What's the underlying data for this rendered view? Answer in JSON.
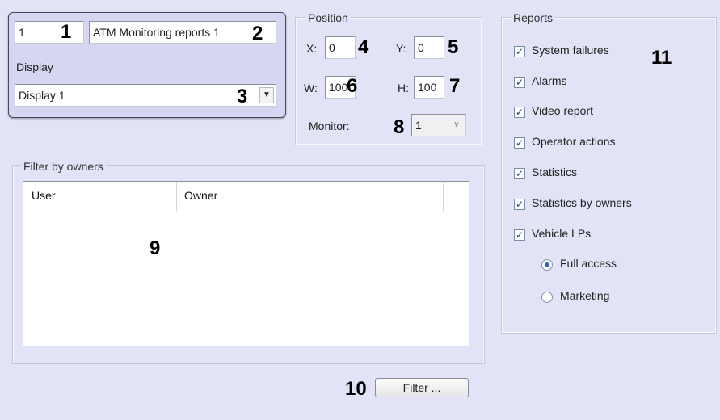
{
  "top_panel": {
    "id_value": "1",
    "name_value": "ATM Monitoring reports 1",
    "display_label": "Display",
    "display_value": "Display 1"
  },
  "position": {
    "legend": "Position",
    "x_label": "X:",
    "x_value": "0",
    "y_label": "Y:",
    "y_value": "0",
    "w_label": "W:",
    "w_value": "100",
    "h_label": "H:",
    "h_value": "100",
    "monitor_label": "Monitor:",
    "monitor_value": "1"
  },
  "filter_group": {
    "legend": "Filter by owners",
    "columns": [
      "User",
      "Owner"
    ],
    "filter_button": "Filter ..."
  },
  "reports": {
    "legend": "Reports",
    "items": [
      {
        "label": "System failures",
        "checked": true
      },
      {
        "label": "Alarms",
        "checked": true
      },
      {
        "label": "Video report",
        "checked": true
      },
      {
        "label": "Operator actions",
        "checked": true
      },
      {
        "label": "Statistics",
        "checked": true
      },
      {
        "label": "Statistics by owners",
        "checked": true
      },
      {
        "label": "Vehicle LPs",
        "checked": true
      }
    ],
    "radios": [
      {
        "label": "Full access",
        "selected": true
      },
      {
        "label": "Marketing",
        "selected": false
      }
    ]
  },
  "callouts": {
    "c1": "1",
    "c2": "2",
    "c3": "3",
    "c4": "4",
    "c5": "5",
    "c6": "6",
    "c7": "7",
    "c8": "8",
    "c9": "9",
    "c10": "10",
    "c11": "11"
  },
  "icons": {
    "dropdown": "chevron-down-icon",
    "check": "check-icon",
    "radio": "radio-icon"
  }
}
